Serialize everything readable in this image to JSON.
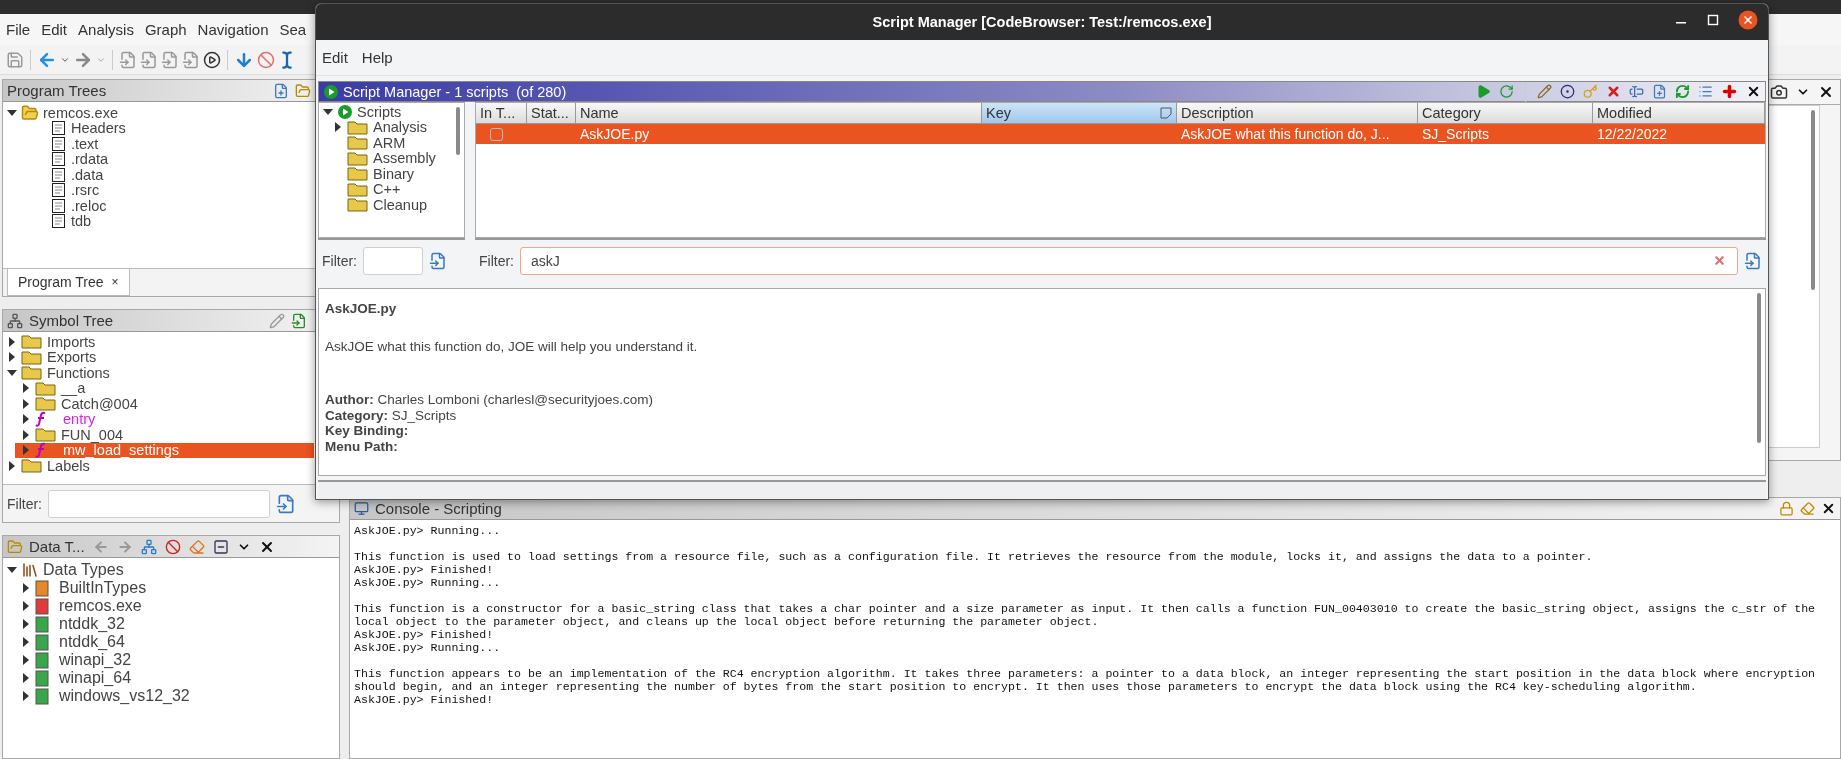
{
  "app_menu": [
    "File",
    "Edit",
    "Analysis",
    "Graph",
    "Navigation",
    "Sea"
  ],
  "program_trees": {
    "title": "Program Trees",
    "tree": [
      {
        "label": "remcos.exe",
        "expanded": true,
        "children": [
          {
            "label": "Headers"
          },
          {
            "label": ".text"
          },
          {
            "label": ".rdata"
          },
          {
            "label": ".data"
          },
          {
            "label": ".rsrc"
          },
          {
            "label": ".reloc"
          },
          {
            "label": "tdb"
          }
        ]
      }
    ],
    "tab": "Program Tree",
    "tab_close": "×"
  },
  "symbol_tree": {
    "title": "Symbol Tree",
    "items": [
      {
        "label": "Imports",
        "kind": "folder",
        "expanded": false,
        "selected": false
      },
      {
        "label": "Exports",
        "kind": "folder",
        "expanded": false,
        "selected": false
      },
      {
        "label": "Functions",
        "kind": "folder",
        "expanded": true,
        "selected": false,
        "children": [
          {
            "label": "__a",
            "kind": "folder",
            "expanded": false,
            "selected": false
          },
          {
            "label": "Catch@004",
            "kind": "folder",
            "expanded": false,
            "selected": false
          },
          {
            "label": "entry",
            "kind": "function",
            "expanded": false,
            "selected": false
          },
          {
            "label": "FUN_004",
            "kind": "folder",
            "expanded": false,
            "selected": false
          },
          {
            "label": "mw_load_settings",
            "kind": "function",
            "expanded": false,
            "selected": true
          }
        ]
      },
      {
        "label": "Labels",
        "kind": "folder",
        "expanded": false,
        "selected": false
      }
    ],
    "filter_label": "Filter:"
  },
  "data_types": {
    "title": "Data T...",
    "tree": [
      {
        "label": "Data Types",
        "expanded": true,
        "children": [
          {
            "label": "BuiltInTypes",
            "color": "#e8862a"
          },
          {
            "label": "remcos.exe",
            "color": "#e03a3a"
          },
          {
            "label": "ntddk_32",
            "color": "#3aa64a"
          },
          {
            "label": "ntddk_64",
            "color": "#3aa64a"
          },
          {
            "label": "winapi_32",
            "color": "#3aa64a"
          },
          {
            "label": "winapi_64",
            "color": "#3aa64a"
          },
          {
            "label": "windows_vs12_32",
            "color": "#3aa64a"
          }
        ]
      }
    ]
  },
  "console": {
    "title": "Console - Scripting",
    "entries": [
      {
        "kind": "running",
        "text": "AskJOE.py> Running..."
      },
      {
        "kind": "output",
        "text": "This function is used to load settings from a resource file, such as a configuration file. It retrieves the resource from the module, locks it, and assigns the data to a pointer."
      },
      {
        "kind": "output",
        "text": "AskJOE.py> Finished!"
      },
      {
        "kind": "running",
        "text": "AskJOE.py> Running..."
      },
      {
        "kind": "output",
        "text": "This function is a constructor for a basic_string class that takes a char pointer and a size parameter as input. It then calls a function FUN_00403010 to create the basic_string object, assigns the c_str of the local object to the parameter object, and cleans up the local object before returning the parameter object."
      },
      {
        "kind": "output",
        "text": "AskJOE.py> Finished!"
      },
      {
        "kind": "running",
        "text": "AskJOE.py> Running..."
      },
      {
        "kind": "output",
        "text": "This function appears to be an implementation of the RC4 encryption algorithm. It takes three parameters: a pointer to a data block, an integer representing the start position in the data block where encryption should begin, and an integer representing the number of bytes from the start position to encrypt. It then uses those parameters to encrypt the data block using the RC4 key-scheduling algorithm."
      },
      {
        "kind": "output",
        "text": "AskJOE.py> Finished!"
      }
    ]
  },
  "dialog": {
    "title": "Script Manager [CodeBrowser: Test:/remcos.exe]",
    "menu": [
      "Edit",
      "Help"
    ],
    "header": "Script Manager - 1 scripts  (of 280)",
    "categories": {
      "label": "Scripts",
      "expanded": true,
      "children": [
        {
          "label": "Analysis",
          "expandable": true
        },
        {
          "label": "ARM",
          "expandable": false
        },
        {
          "label": "Assembly",
          "expandable": false
        },
        {
          "label": "Binary",
          "expandable": false
        },
        {
          "label": "C++",
          "expandable": false
        },
        {
          "label": "Cleanup",
          "expandable": false
        }
      ]
    },
    "columns": [
      {
        "label": "In T...",
        "sorted": false
      },
      {
        "label": "Stat...",
        "sorted": false
      },
      {
        "label": "Name",
        "sorted": false
      },
      {
        "label": "Key",
        "sorted": true
      },
      {
        "label": "Description",
        "sorted": false
      },
      {
        "label": "Category",
        "sorted": false
      },
      {
        "label": "Modified",
        "sorted": false
      }
    ],
    "rows": [
      {
        "checked": false,
        "selected": true,
        "name": "AskJOE.py",
        "description": "AskJOE what this function do, J...",
        "category": "SJ_Scripts",
        "modified": "12/22/2022"
      }
    ],
    "category_filter": {
      "label": "Filter:"
    },
    "script_filter": {
      "label": "Filter:",
      "value": "askJ"
    },
    "details": {
      "title": "AskJOE.py",
      "description": "AskJOE what this function do, JOE will help you understand it.",
      "fields": [
        {
          "label": "Author:",
          "value": "Charles Lomboni (charlesl@securityjoes.com)"
        },
        {
          "label": "Category:",
          "value": "SJ_Scripts"
        },
        {
          "label": "Key Binding:"
        },
        {
          "label": "Menu Path:"
        }
      ]
    }
  }
}
